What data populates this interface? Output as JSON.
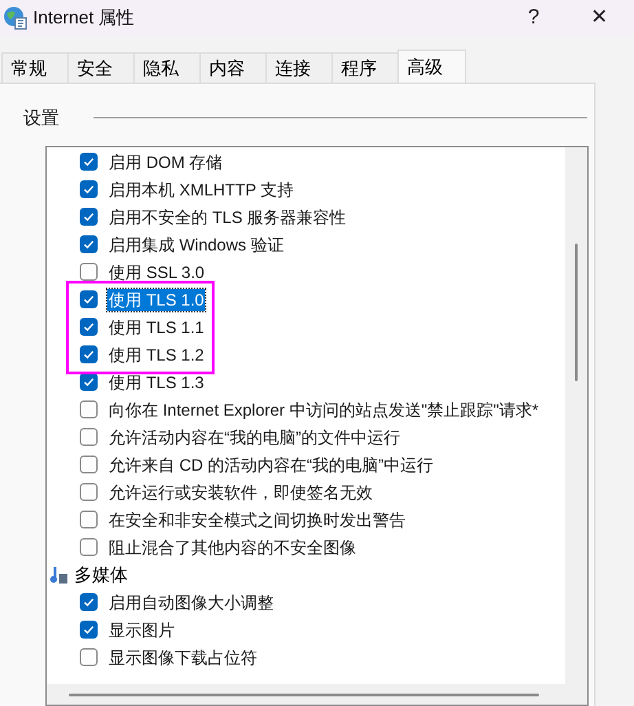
{
  "window": {
    "title": "Internet 属性",
    "help": "?",
    "close": "✕"
  },
  "tabs": [
    {
      "label": "常规",
      "selected": false
    },
    {
      "label": "安全",
      "selected": false
    },
    {
      "label": "隐私",
      "selected": false
    },
    {
      "label": "内容",
      "selected": false
    },
    {
      "label": "连接",
      "selected": false
    },
    {
      "label": "程序",
      "selected": false
    },
    {
      "label": "高级",
      "selected": true
    }
  ],
  "settings": {
    "label": "设置",
    "groups": [
      {
        "items": [
          {
            "label": "启用 DOM 存储",
            "checked": true,
            "selected": false,
            "highlighted": false
          },
          {
            "label": "启用本机 XMLHTTP 支持",
            "checked": true,
            "selected": false,
            "highlighted": false
          },
          {
            "label": "启用不安全的 TLS 服务器兼容性",
            "checked": true,
            "selected": false,
            "highlighted": false
          },
          {
            "label": "启用集成 Windows 验证",
            "checked": true,
            "selected": false,
            "highlighted": false
          },
          {
            "label": "使用 SSL 3.0",
            "checked": false,
            "selected": false,
            "highlighted": false
          },
          {
            "label": "使用 TLS 1.0",
            "checked": true,
            "selected": true,
            "highlighted": true
          },
          {
            "label": "使用 TLS 1.1",
            "checked": true,
            "selected": false,
            "highlighted": true
          },
          {
            "label": "使用 TLS 1.2",
            "checked": true,
            "selected": false,
            "highlighted": true
          },
          {
            "label": "使用 TLS 1.3",
            "checked": true,
            "selected": false,
            "highlighted": false
          },
          {
            "label": "向你在 Internet Explorer 中访问的站点发送\"禁止跟踪\"请求*",
            "checked": false,
            "selected": false,
            "highlighted": false
          },
          {
            "label": "允许活动内容在“我的电脑”的文件中运行",
            "checked": false,
            "selected": false,
            "highlighted": false
          },
          {
            "label": "允许来自 CD 的活动内容在“我的电脑”中运行",
            "checked": false,
            "selected": false,
            "highlighted": false
          },
          {
            "label": "允许运行或安装软件，即使签名无效",
            "checked": false,
            "selected": false,
            "highlighted": false
          },
          {
            "label": "在安全和非安全模式之间切换时发出警告",
            "checked": false,
            "selected": false,
            "highlighted": false
          },
          {
            "label": "阻止混合了其他内容的不安全图像",
            "checked": false,
            "selected": false,
            "highlighted": false
          }
        ]
      },
      {
        "label": "多媒体",
        "items": [
          {
            "label": "启用自动图像大小调整",
            "checked": true,
            "selected": false,
            "highlighted": false
          },
          {
            "label": "显示图片",
            "checked": true,
            "selected": false,
            "highlighted": false
          },
          {
            "label": "显示图像下载占位符",
            "checked": false,
            "selected": false,
            "highlighted": false
          }
        ]
      }
    ]
  }
}
